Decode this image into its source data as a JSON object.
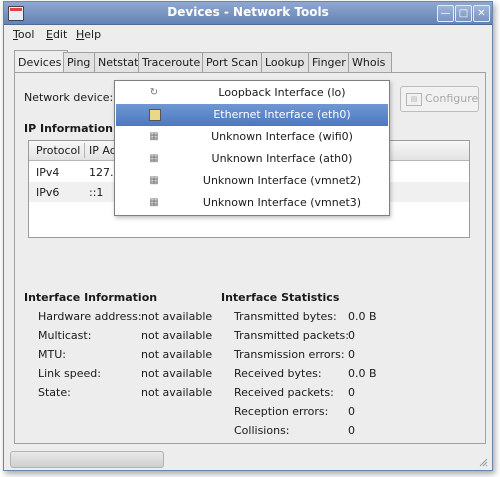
{
  "window": {
    "title": "Devices - Network Tools"
  },
  "menubar": [
    {
      "label": "Tool",
      "mnemonic": "T"
    },
    {
      "label": "Edit",
      "mnemonic": "E"
    },
    {
      "label": "Help",
      "mnemonic": "H"
    }
  ],
  "tabs": [
    "Devices",
    "Ping",
    "Netstat",
    "Traceroute",
    "Port Scan",
    "Lookup",
    "Finger",
    "Whois"
  ],
  "devices": {
    "network_device_label": "Network device:",
    "configure_label": "Configure",
    "ip_information_heading": "IP Information",
    "ip_table": {
      "columns": [
        "Protocol",
        "IP Ad"
      ],
      "rows": [
        {
          "protocol": "IPv4",
          "address": "127.0"
        },
        {
          "protocol": "IPv6",
          "address": "::1"
        }
      ]
    },
    "dropdown": {
      "items": [
        {
          "label": "Loopback Interface (lo)",
          "icon": "loopback-icon",
          "selected": false
        },
        {
          "label": "Ethernet Interface (eth0)",
          "icon": "ethernet-icon",
          "selected": true
        },
        {
          "label": "Unknown Interface (wifi0)",
          "icon": "network-icon",
          "selected": false
        },
        {
          "label": "Unknown Interface (ath0)",
          "icon": "network-icon",
          "selected": false
        },
        {
          "label": "Unknown Interface (vmnet2)",
          "icon": "network-icon",
          "selected": false
        },
        {
          "label": "Unknown Interface (vmnet3)",
          "icon": "network-icon",
          "selected": false
        }
      ]
    },
    "interface_information": {
      "heading": "Interface Information",
      "fields": [
        {
          "label": "Hardware address:",
          "value": "not available"
        },
        {
          "label": "Multicast:",
          "value": "not available"
        },
        {
          "label": "MTU:",
          "value": "not available"
        },
        {
          "label": "Link speed:",
          "value": "not available"
        },
        {
          "label": "State:",
          "value": "not available"
        }
      ]
    },
    "interface_statistics": {
      "heading": "Interface Statistics",
      "fields": [
        {
          "label": "Transmitted bytes:",
          "value": "0.0 B"
        },
        {
          "label": "Transmitted packets:",
          "value": "0"
        },
        {
          "label": "Transmission errors:",
          "value": "0"
        },
        {
          "label": "Received bytes:",
          "value": "0.0 B"
        },
        {
          "label": "Received packets:",
          "value": "0"
        },
        {
          "label": "Reception errors:",
          "value": "0"
        },
        {
          "label": "Collisions:",
          "value": "0"
        }
      ]
    }
  },
  "colors": {
    "titlebar": "#7893c2",
    "selection": "#5a84c8"
  }
}
